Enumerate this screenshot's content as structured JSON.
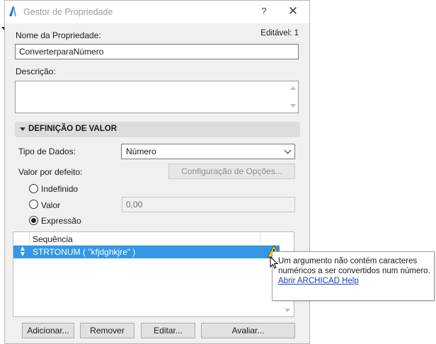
{
  "window": {
    "title": "Gestor de Propriedade"
  },
  "titlebar": {
    "help": "?",
    "close": "✕"
  },
  "property": {
    "name_label": "Nome da Propriedade:",
    "editable": "Editável: 1",
    "name_value": "ConverterparaNúmero",
    "description_label": "Descrição:"
  },
  "value_section": {
    "title": "DEFINIÇÃO DE VALOR",
    "data_type_label": "Tipo de Dados:",
    "data_type_value": "Número",
    "default_label": "Valor por defeito:",
    "options_button": "Configuração de Opções...",
    "radio_undefined": "Indefinido",
    "radio_value": "Valor",
    "value_field": "0,00",
    "radio_expression": "Expressão",
    "selected_radio": "Expressão"
  },
  "expression_list": {
    "header": "Sequência",
    "rows": [
      {
        "text": "STRTONUM ( \"kfjdghkjre\" )"
      }
    ]
  },
  "tooltip": {
    "line1": "Um argumento não contém caracteres",
    "line2": "numéricos a ser convertidos num número.",
    "link": "Abrir ARCHICAD Help"
  },
  "buttons": {
    "add": "Adicionar...",
    "remove": "Remover",
    "edit": "Editar...",
    "evaluate": "Avaliar..."
  },
  "colors": {
    "selection": "#3298e6",
    "link": "#1a3fb0",
    "warning": "#f5d21c"
  }
}
